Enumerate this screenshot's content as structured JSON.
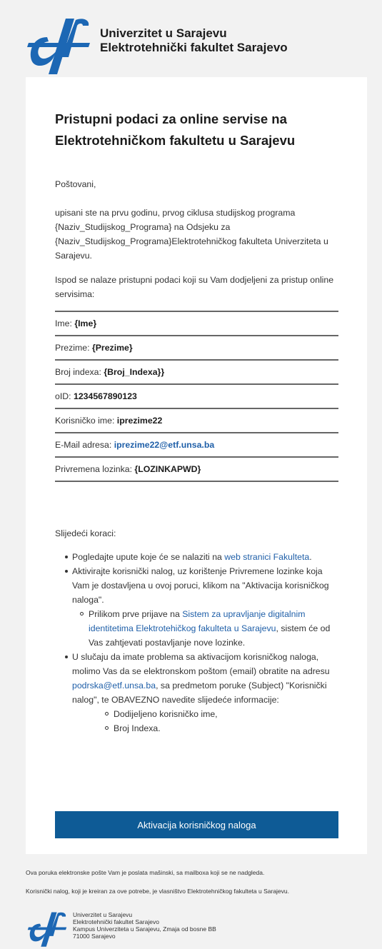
{
  "colors": {
    "brand": "#1c67b4",
    "button": "#0e5b96",
    "link": "#1f5fa8",
    "divider": "#666666"
  },
  "header": {
    "logo_icon": "etf-logo-icon",
    "line1": "Univerzitet u Sarajevu",
    "line2": "Elektrotehnički fakultet Sarajevo"
  },
  "email": {
    "title": "Pristupni podaci za online servise na Elektrotehničkom fakultetu u Sarajevu",
    "greeting": "Poštovani,",
    "intro": "upisani ste na prvu godinu, prvog ciklusa studijskog programa {Naziv_Studijskog_Programa} na Odsjeku za {Naziv_Studijskog_Programa}Elektrotehničkog fakulteta Univerziteta u Sarajevu.",
    "below": "Ispod se nalaze pristupni podaci koji su Vam dodjeljeni za pristup online servisima:",
    "fields": [
      {
        "label": "Ime: ",
        "value": "{Ime}"
      },
      {
        "label": "Prezime: ",
        "value": "{Prezime}"
      },
      {
        "label": "Broj indexa: ",
        "value": "{Broj_Indexa}}"
      },
      {
        "label": "oID: ",
        "value": "1234567890123"
      },
      {
        "label": "Korisničko ime: ",
        "value": "iprezime22"
      },
      {
        "label": "E-Mail adresa: ",
        "value": "iprezime22@etf.unsa.ba"
      },
      {
        "label": "Privremena lozinka: ",
        "value": "{LOZINKAPWD}"
      }
    ],
    "next_steps_label": "Slijedeći koraci:",
    "step1_text": "Pogledajte upute koje će se nalaziti na ",
    "step1_link": "web stranici Fakulteta",
    "step1_end": ".",
    "step2_text": "Aktivirajte korisnički nalog, uz korištenje Privremene lozinke koja Vam je dostavljena u ovoj poruci, klikom na \"Aktivacija korisničkog naloga\".",
    "step2_sub_text": "Prilikom prve prijave na ",
    "step2_sub_link": "Sistem za upravljanje digitalnim identitetima Elektrotehičkog fakulteta u Sarajevu",
    "step2_sub_end": ", sistem će od Vas zahtjevati postavljanje nove lozinke.",
    "step3_text": "U slučaju da imate problema sa aktivacijom korisničkog naloga, molimo Vas da se elektronskom poštom (email) obratite na adresu ",
    "step3_link": "podrska@etf.unsa.ba",
    "step3_end": ", sa predmetom poruke (Subject) \"Korisnički nalog\", te OBAVEZNO navedite slijedeće informacije:",
    "step3_sub": [
      "Dodijeljeno korisničko ime,",
      "Broj Indexa."
    ],
    "button_label": "Aktivacija korisničkog naloga"
  },
  "footer": {
    "note1": "Ova poruka elektronske pošte Vam je poslata mašinski, sa mailboxa koji se ne nadgleda.",
    "note2": "Korisnički nalog, koji je kreiran za ove potrebe, je vlasništvo Elektrotehničkog fakulteta u Sarajevu.",
    "address": [
      "Univerzitet u Sarajevu",
      "Elektrotehnički fakultet Sarajevo",
      "Kampus Univerziteta u Sarajevu, Zmaja od bosne BB",
      "71000 Sarajevo"
    ]
  }
}
